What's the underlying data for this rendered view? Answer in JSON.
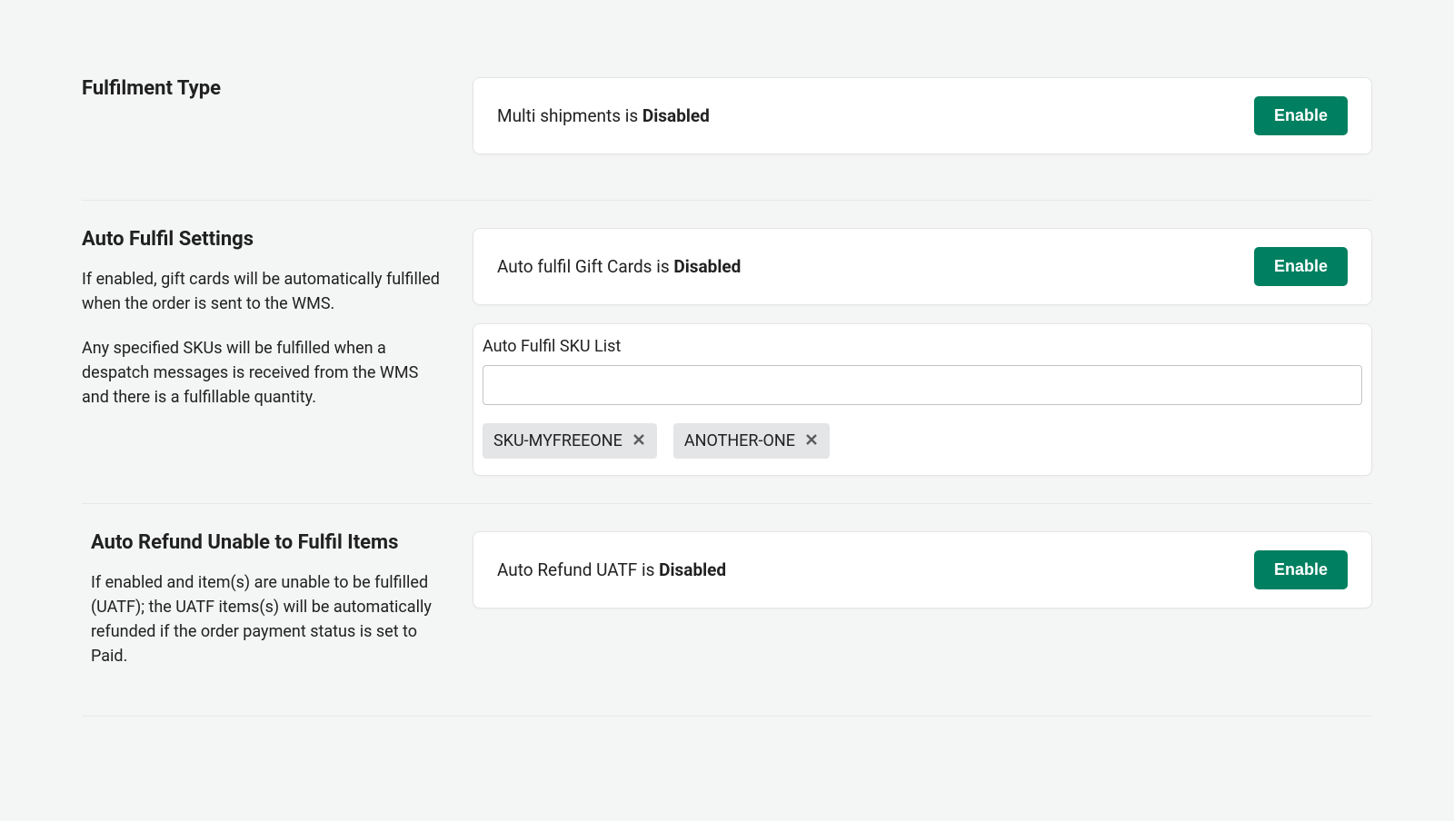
{
  "sections": {
    "fulfilment": {
      "title": "Fulfilment Type",
      "status_prefix": "Multi shipments is ",
      "status_value": "Disabled",
      "button": "Enable"
    },
    "autofulfil": {
      "title": "Auto Fulfil Settings",
      "desc1": "If enabled, gift cards will be automatically fulfilled when the order is sent to the WMS.",
      "desc2": "Any specified SKUs will be fulfilled when a despatch messages is received from the WMS and there is a fulfillable quantity.",
      "status_prefix": "Auto fulfil Gift Cards is ",
      "status_value": "Disabled",
      "button": "Enable",
      "sku_label": "Auto Fulfil SKU List",
      "sku_value": "",
      "tags": [
        "SKU-MYFREEONE",
        "ANOTHER-ONE"
      ]
    },
    "autorefund": {
      "title": "Auto Refund Unable to Fulfil Items",
      "desc": "If enabled and item(s) are unable to be fulfilled (UATF); the UATF items(s) will be automatically refunded if the order payment status is set to Paid.",
      "status_prefix": "Auto Refund UATF is ",
      "status_value": "Disabled",
      "button": "Enable"
    }
  }
}
